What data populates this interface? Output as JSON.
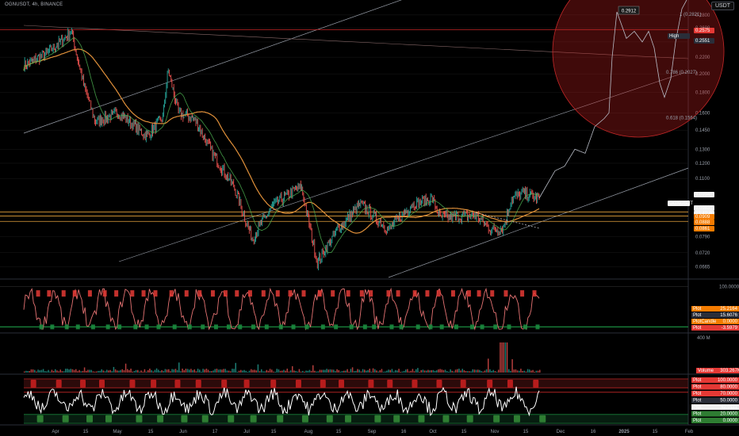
{
  "header": {
    "ticker_line": "OGNUSDT, 4h, BINANCE",
    "currency": "USDT"
  },
  "colors": {
    "bg": "#000000",
    "ma_orange": "#e0903a",
    "ma_green": "#4caf50",
    "red": "#e53935",
    "green": "#1b8a3e",
    "grid": "#1a1a1a"
  },
  "chart_data": [
    {
      "type": "line",
      "name": "price",
      "title": "OGNUSDT",
      "ylim": [
        0.0625,
        0.305
      ],
      "y_ticks": [
        "0.2800",
        "0.2600",
        "0.2400",
        "0.2200",
        "0.2000",
        "0.1800",
        "0.1600",
        "0.1450",
        "0.1300",
        "0.1200",
        "0.1100",
        "0.0790",
        "0.0720",
        "0.0665"
      ],
      "x_ticks": [
        "Apr",
        "15",
        "May",
        "15",
        "Jun",
        "17",
        "Jul",
        "15",
        "Aug",
        "15",
        "Sep",
        "16",
        "Oct",
        "15",
        "Nov",
        "15",
        "Dec",
        "16",
        "2025",
        "15",
        "Feb"
      ],
      "price_labels": [
        {
          "text": "0.2575",
          "kind": "red"
        },
        {
          "text": "High",
          "kind": "dark"
        },
        {
          "text": "0.2551",
          "kind": "dark"
        },
        {
          "text": "0.0994",
          "kind": "white"
        },
        {
          "text": "OGNUSDT",
          "kind": "white"
        },
        {
          "text": "0.0983",
          "kind": "white"
        },
        {
          "text": "03:40:46",
          "kind": "white"
        },
        {
          "text": "0.0909",
          "kind": "orange"
        },
        {
          "text": "0.0888",
          "kind": "orange"
        },
        {
          "text": "0.0861",
          "kind": "orange"
        }
      ],
      "fib_levels": [
        {
          "label": "1 (0.2821)",
          "value": 0.2821
        },
        {
          "label": "0.786 (0.2027)",
          "value": 0.2027
        },
        {
          "label": "0.618 (0.1564)",
          "value": 0.1564
        }
      ],
      "projection_label": "0.2912",
      "horizontal_levels": [
        0.2575,
        0.0909,
        0.0888,
        0.0861
      ]
    },
    {
      "type": "line",
      "name": "oscillator",
      "ylim": [
        0,
        110
      ],
      "y_ticks": [
        "100.0000"
      ],
      "labels": [
        {
          "text": "Plot",
          "value": "25.2164",
          "kind": "orange"
        },
        {
          "text": "Plot",
          "value": "15.6076",
          "kind": "dark"
        },
        {
          "text": "PlotCandle",
          "value": "0.0000",
          "kind": "orange"
        },
        {
          "text": "Plot",
          "value": "-3.5979",
          "kind": "red"
        }
      ]
    },
    {
      "type": "bar",
      "name": "volume",
      "y_ticks": [
        "400 M"
      ],
      "labels": [
        {
          "text": "Volume",
          "value": "303.267K",
          "kind": "red"
        }
      ]
    },
    {
      "type": "line",
      "name": "rsi",
      "ylim": [
        0,
        100
      ],
      "labels": [
        {
          "text": "Plot",
          "value": "100.0000",
          "kind": "red"
        },
        {
          "text": "Plot",
          "value": "80.0000",
          "kind": "red"
        },
        {
          "text": "Plot",
          "value": "70.0000",
          "kind": "red"
        },
        {
          "text": "Plot",
          "value": "50.0000",
          "kind": "dark"
        },
        {
          "text": "Plot",
          "value": "42.0111",
          "kind": "white"
        },
        {
          "text": "Plot",
          "value": "20.0000",
          "kind": "green"
        },
        {
          "text": "Plot",
          "value": "0.0000",
          "kind": "green"
        }
      ]
    }
  ]
}
